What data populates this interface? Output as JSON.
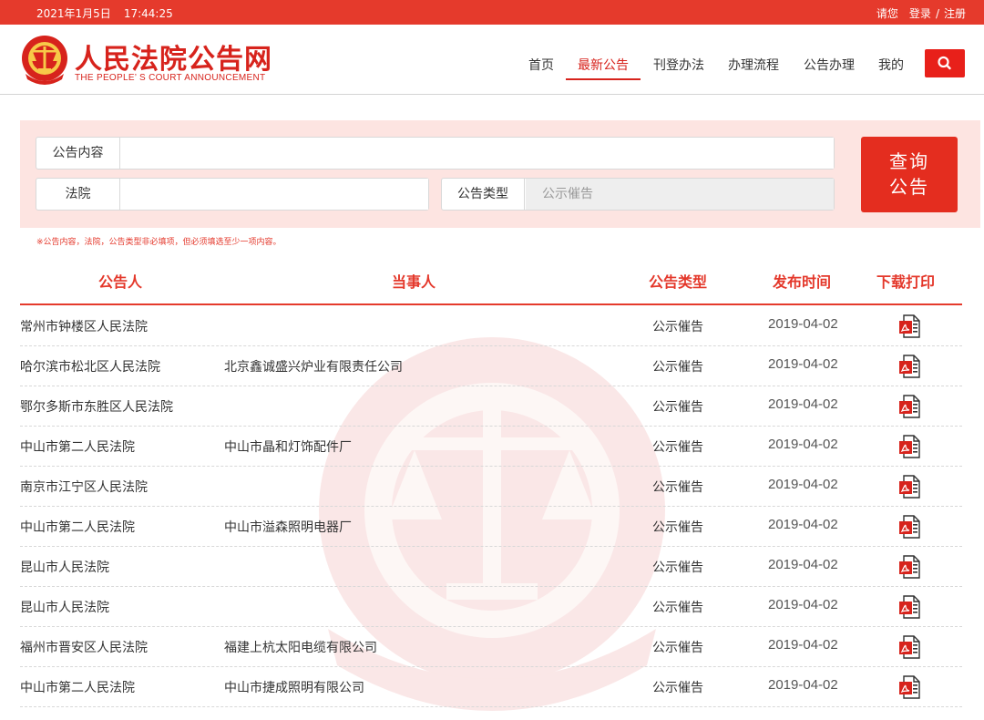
{
  "topbar": {
    "date": "2021年1月5日",
    "time": "17:44:25",
    "greeting": "请您",
    "login": "登录",
    "separator": "/",
    "register": "注册"
  },
  "header": {
    "title": "人民法院公告网",
    "subtitle": "THE PEOPLE’ S COURT ANNOUNCEMENT"
  },
  "nav": {
    "items": [
      "首页",
      "最新公告",
      "刊登办法",
      "办理流程",
      "公告办理",
      "我的"
    ],
    "active": "最新公告",
    "search_icon": "search-icon"
  },
  "search": {
    "content_label": "公告内容",
    "content_value": "",
    "court_label": "法院",
    "court_value": "",
    "type_label": "公告类型",
    "type_value": "公示催告",
    "button_line1": "查询",
    "button_line2": "公告",
    "note": "※公告内容，法院，公告类型非必填项，但必须填选至少一项内容。"
  },
  "table": {
    "headers": [
      "公告人",
      "当事人",
      "公告类型",
      "发布时间",
      "下载打印"
    ],
    "rows": [
      {
        "announcer": "常州市钟楼区人民法院",
        "party": "",
        "type": "公示催告",
        "date": "2019-04-02"
      },
      {
        "announcer": "哈尔滨市松北区人民法院",
        "party": "北京鑫诚盛兴炉业有限责任公司",
        "type": "公示催告",
        "date": "2019-04-02"
      },
      {
        "announcer": "鄂尔多斯市东胜区人民法院",
        "party": "",
        "type": "公示催告",
        "date": "2019-04-02"
      },
      {
        "announcer": "中山市第二人民法院",
        "party": "中山市晶和灯饰配件厂",
        "type": "公示催告",
        "date": "2019-04-02"
      },
      {
        "announcer": "南京市江宁区人民法院",
        "party": "",
        "type": "公示催告",
        "date": "2019-04-02"
      },
      {
        "announcer": "中山市第二人民法院",
        "party": "中山市溢森照明电器厂",
        "type": "公示催告",
        "date": "2019-04-02"
      },
      {
        "announcer": "昆山市人民法院",
        "party": "",
        "type": "公示催告",
        "date": "2019-04-02"
      },
      {
        "announcer": "昆山市人民法院",
        "party": "",
        "type": "公示催告",
        "date": "2019-04-02"
      },
      {
        "announcer": "福州市晋安区人民法院",
        "party": "福建上杭太阳电缆有限公司",
        "type": "公示催告",
        "date": "2019-04-02"
      },
      {
        "announcer": "中山市第二人民法院",
        "party": "中山市捷成照明有限公司",
        "type": "公示催告",
        "date": "2019-04-02"
      }
    ],
    "download_icon": "pdf-icon"
  },
  "colors": {
    "brand_red": "#e53a2c",
    "panel_bg": "#fde4e1"
  }
}
